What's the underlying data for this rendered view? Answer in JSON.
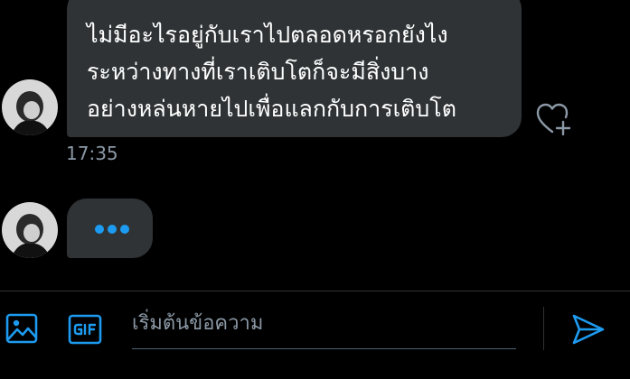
{
  "conversation": {
    "incoming_message": {
      "lines": [
        "ไม่มีอะไรอยู่กับเราไปตลอดหรอกยังไง",
        "ระหว่างทางที่เราเติบโตก็จะมีสิ่งบาง",
        "อย่างหล่นหายไปเพื่อแลกกับการเติบโต"
      ],
      "timestamp": "17:35"
    }
  },
  "composer": {
    "placeholder": "เริ่มต้นข้อความ"
  },
  "icons": {
    "avatar": "avatar-photo",
    "reaction": "heart-plus-icon",
    "typing": "typing-dots-icon",
    "media": "image-icon",
    "gif": "gif-icon",
    "send": "send-icon"
  },
  "colors": {
    "background": "#000000",
    "bubble": "#2f3336",
    "accent": "#1d9bf0",
    "secondary_text": "#8b98a5"
  }
}
